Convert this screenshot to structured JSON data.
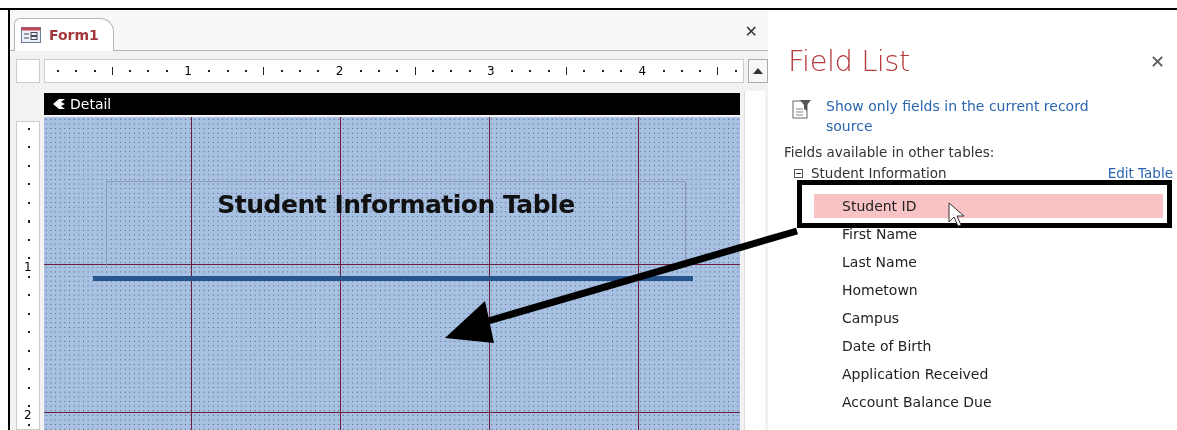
{
  "form": {
    "tab": {
      "title": "Form1",
      "selected": true
    },
    "close": "✕",
    "ruler_numbers": [
      "1",
      "2",
      "3",
      "4"
    ],
    "vertical_ruler_numbers": [
      "1",
      "2"
    ],
    "section": "Detail",
    "label": "Student Information Table"
  },
  "field_list": {
    "title": "Field List",
    "close": "✕",
    "show_only_link": "Show only fields in the current record source",
    "heading": "Fields available in other tables:",
    "table": {
      "name": "Student Information",
      "expanded": true,
      "edit_link": "Edit Table",
      "fields": [
        {
          "name": "Student ID",
          "selected": true
        },
        {
          "name": "First Name",
          "selected": false
        },
        {
          "name": "Last Name",
          "selected": false
        },
        {
          "name": "Hometown",
          "selected": false
        },
        {
          "name": "Campus",
          "selected": false
        },
        {
          "name": "Date of Birth",
          "selected": false
        },
        {
          "name": "Application Received",
          "selected": false
        },
        {
          "name": "Account Balance Due",
          "selected": false
        }
      ]
    }
  }
}
